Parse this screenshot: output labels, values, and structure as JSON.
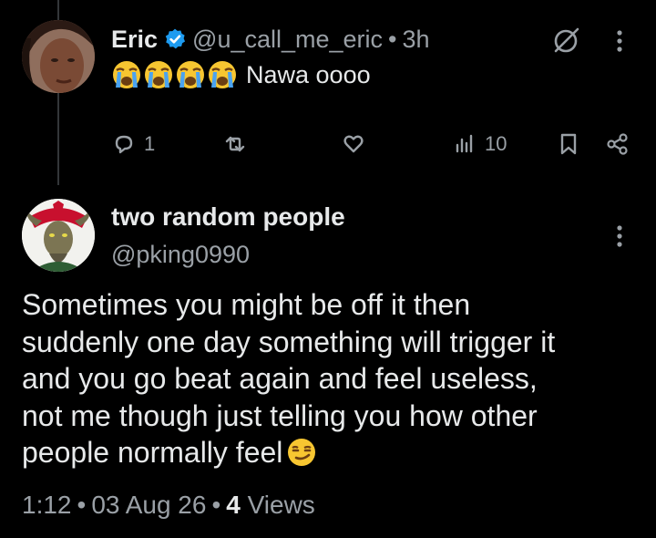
{
  "reply": {
    "author_name": "Eric",
    "handle": "@u_call_me_eric",
    "separator": "•",
    "time": "3h",
    "emojis": [
      "loudly-crying-face",
      "loudly-crying-face",
      "loudly-crying-face",
      "loudly-crying-face"
    ],
    "text": "Nawa oooo",
    "actions": {
      "reply_count": "1",
      "repost_count": "",
      "like_count": "",
      "views_count": "10"
    }
  },
  "post": {
    "author_name": "two random people",
    "handle": "@pking0990",
    "text_lines": [
      "Sometimes you might be off it then",
      "suddenly one day something will trigger it",
      "and you go beat again and feel useless,",
      "not me though just telling you how other",
      "people normally feel"
    ],
    "trailing_emoji": "smirking-face",
    "meta": {
      "time": "1:12",
      "separator": "•",
      "date": "03 Aug 26",
      "views_number": "4",
      "views_label": "Views"
    }
  },
  "colors": {
    "background": "#000000",
    "text_primary": "#e7e9ea",
    "text_secondary": "#9aa0a6",
    "verified_blue": "#1d9bf0"
  }
}
